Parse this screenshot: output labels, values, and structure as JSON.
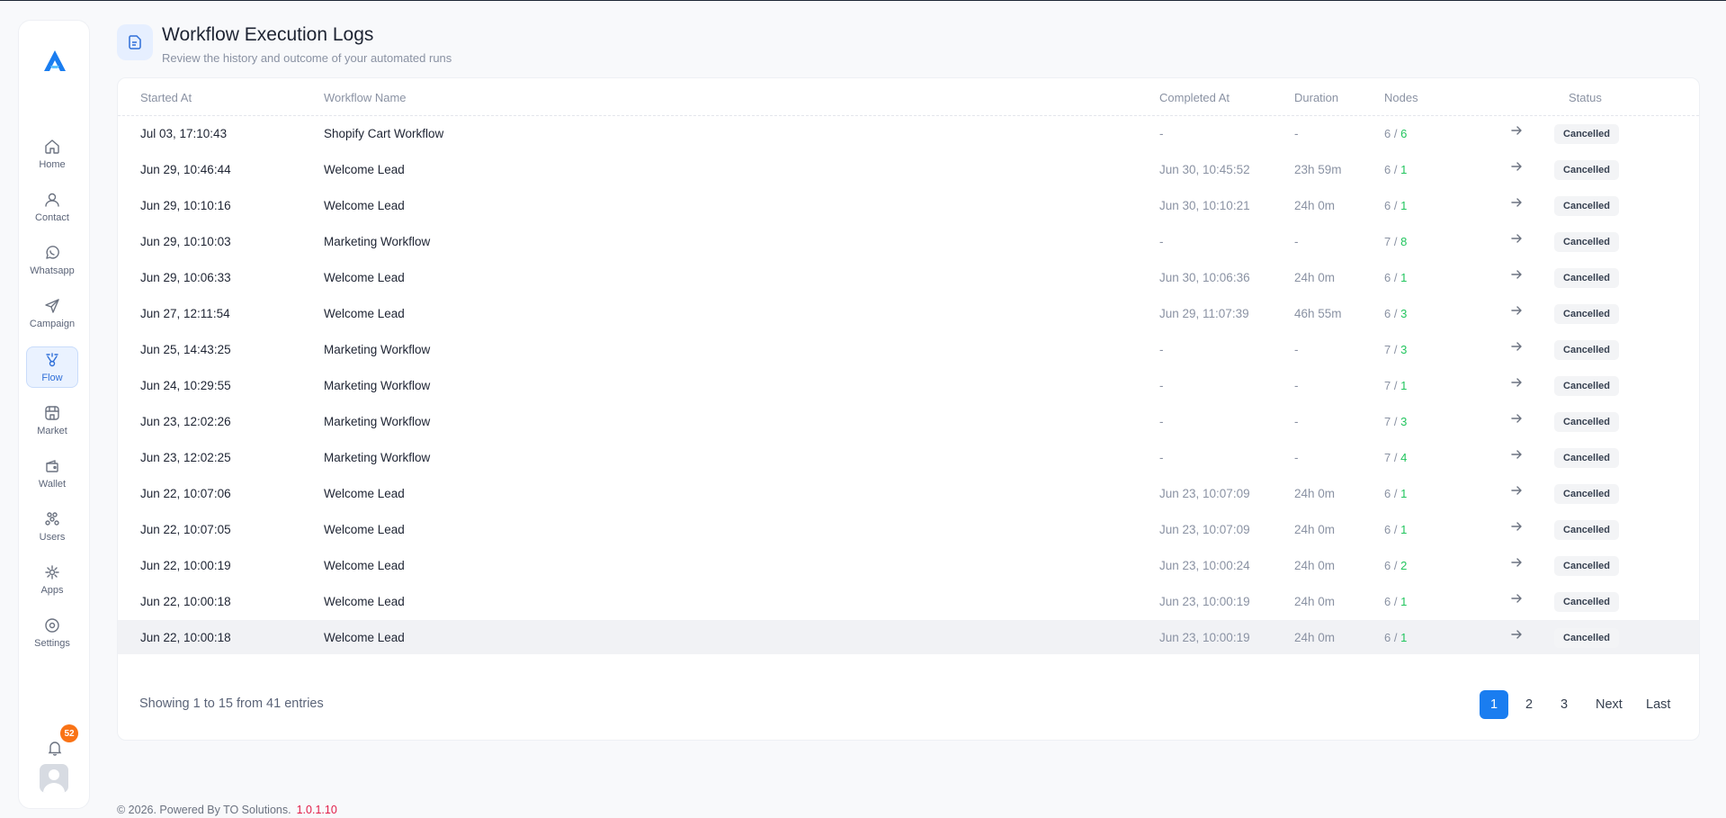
{
  "sidebar": {
    "items": [
      {
        "label": "Home",
        "icon": "home-icon"
      },
      {
        "label": "Contact",
        "icon": "contact-icon"
      },
      {
        "label": "Whatsapp",
        "icon": "whatsapp-icon"
      },
      {
        "label": "Campaign",
        "icon": "send-icon"
      },
      {
        "label": "Flow",
        "icon": "flow-icon",
        "active": true
      },
      {
        "label": "Market",
        "icon": "store-icon"
      },
      {
        "label": "Wallet",
        "icon": "wallet-icon"
      },
      {
        "label": "Users",
        "icon": "users-icon"
      },
      {
        "label": "Apps",
        "icon": "apps-icon"
      },
      {
        "label": "Settings",
        "icon": "settings-icon"
      }
    ],
    "notification_count": "52",
    "accent_color": "#2f6fd8"
  },
  "header": {
    "title": "Workflow Execution Logs",
    "subtitle": "Review the history and outcome of your automated runs"
  },
  "table": {
    "columns": {
      "started_at": "Started At",
      "workflow_name": "Workflow Name",
      "completed_at": "Completed At",
      "duration": "Duration",
      "nodes": "Nodes",
      "status": "Status"
    },
    "rows": [
      {
        "started": "Jul 03, 17:10:43",
        "name": "Shopify Cart Workflow",
        "completed": "-",
        "duration": "-",
        "nodes_total": "6",
        "nodes_done": "6",
        "status": "Cancelled"
      },
      {
        "started": "Jun 29, 10:46:44",
        "name": "Welcome Lead",
        "completed": "Jun 30, 10:45:52",
        "duration": "23h 59m",
        "nodes_total": "6",
        "nodes_done": "1",
        "status": "Cancelled"
      },
      {
        "started": "Jun 29, 10:10:16",
        "name": "Welcome Lead",
        "completed": "Jun 30, 10:10:21",
        "duration": "24h 0m",
        "nodes_total": "6",
        "nodes_done": "1",
        "status": "Cancelled"
      },
      {
        "started": "Jun 29, 10:10:03",
        "name": "Marketing Workflow",
        "completed": "-",
        "duration": "-",
        "nodes_total": "7",
        "nodes_done": "8",
        "status": "Cancelled"
      },
      {
        "started": "Jun 29, 10:06:33",
        "name": "Welcome Lead",
        "completed": "Jun 30, 10:06:36",
        "duration": "24h 0m",
        "nodes_total": "6",
        "nodes_done": "1",
        "status": "Cancelled"
      },
      {
        "started": "Jun 27, 12:11:54",
        "name": "Welcome Lead",
        "completed": "Jun 29, 11:07:39",
        "duration": "46h 55m",
        "nodes_total": "6",
        "nodes_done": "3",
        "status": "Cancelled"
      },
      {
        "started": "Jun 25, 14:43:25",
        "name": "Marketing Workflow",
        "completed": "-",
        "duration": "-",
        "nodes_total": "7",
        "nodes_done": "3",
        "status": "Cancelled"
      },
      {
        "started": "Jun 24, 10:29:55",
        "name": "Marketing Workflow",
        "completed": "-",
        "duration": "-",
        "nodes_total": "7",
        "nodes_done": "1",
        "status": "Cancelled"
      },
      {
        "started": "Jun 23, 12:02:26",
        "name": "Marketing Workflow",
        "completed": "-",
        "duration": "-",
        "nodes_total": "7",
        "nodes_done": "3",
        "status": "Cancelled"
      },
      {
        "started": "Jun 23, 12:02:25",
        "name": "Marketing Workflow",
        "completed": "-",
        "duration": "-",
        "nodes_total": "7",
        "nodes_done": "4",
        "status": "Cancelled"
      },
      {
        "started": "Jun 22, 10:07:06",
        "name": "Welcome Lead",
        "completed": "Jun 23, 10:07:09",
        "duration": "24h 0m",
        "nodes_total": "6",
        "nodes_done": "1",
        "status": "Cancelled"
      },
      {
        "started": "Jun 22, 10:07:05",
        "name": "Welcome Lead",
        "completed": "Jun 23, 10:07:09",
        "duration": "24h 0m",
        "nodes_total": "6",
        "nodes_done": "1",
        "status": "Cancelled"
      },
      {
        "started": "Jun 22, 10:00:19",
        "name": "Welcome Lead",
        "completed": "Jun 23, 10:00:24",
        "duration": "24h 0m",
        "nodes_total": "6",
        "nodes_done": "2",
        "status": "Cancelled"
      },
      {
        "started": "Jun 22, 10:00:18",
        "name": "Welcome Lead",
        "completed": "Jun 23, 10:00:19",
        "duration": "24h 0m",
        "nodes_total": "6",
        "nodes_done": "1",
        "status": "Cancelled"
      },
      {
        "started": "Jun 22, 10:00:18",
        "name": "Welcome Lead",
        "completed": "Jun 23, 10:00:19",
        "duration": "24h 0m",
        "nodes_total": "6",
        "nodes_done": "1",
        "status": "Cancelled",
        "highlighted": true
      }
    ]
  },
  "pagination": {
    "summary": "Showing 1 to 15 from 41 entries",
    "pages": [
      "1",
      "2",
      "3"
    ],
    "current": "1",
    "next_label": "Next",
    "last_label": "Last"
  },
  "footer": {
    "text": "© 2026. Powered By TO Solutions.",
    "version": "1.0.1.10"
  }
}
